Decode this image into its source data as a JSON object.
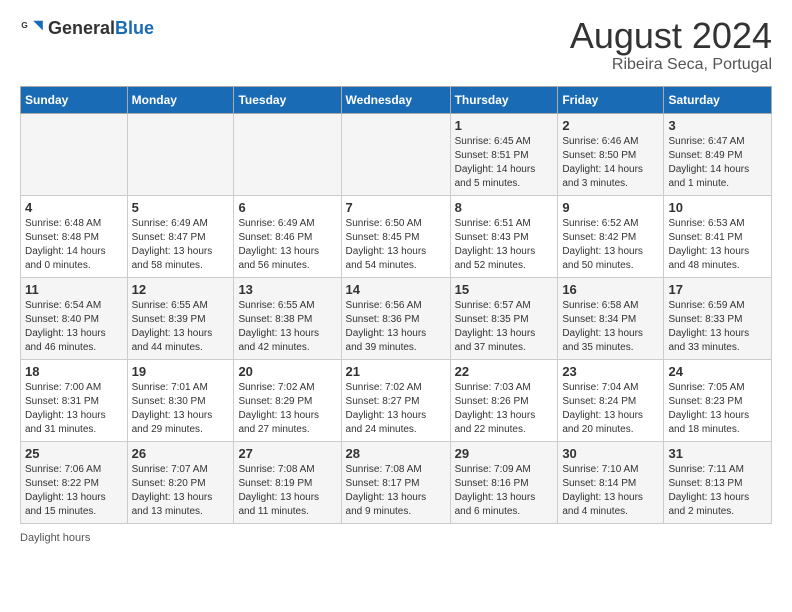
{
  "header": {
    "logo_general": "General",
    "logo_blue": "Blue",
    "title": "August 2024",
    "subtitle": "Ribeira Seca, Portugal"
  },
  "days_of_week": [
    "Sunday",
    "Monday",
    "Tuesday",
    "Wednesday",
    "Thursday",
    "Friday",
    "Saturday"
  ],
  "weeks": [
    [
      {
        "day": "",
        "info": ""
      },
      {
        "day": "",
        "info": ""
      },
      {
        "day": "",
        "info": ""
      },
      {
        "day": "",
        "info": ""
      },
      {
        "day": "1",
        "info": "Sunrise: 6:45 AM\nSunset: 8:51 PM\nDaylight: 14 hours and 5 minutes."
      },
      {
        "day": "2",
        "info": "Sunrise: 6:46 AM\nSunset: 8:50 PM\nDaylight: 14 hours and 3 minutes."
      },
      {
        "day": "3",
        "info": "Sunrise: 6:47 AM\nSunset: 8:49 PM\nDaylight: 14 hours and 1 minute."
      }
    ],
    [
      {
        "day": "4",
        "info": "Sunrise: 6:48 AM\nSunset: 8:48 PM\nDaylight: 14 hours and 0 minutes."
      },
      {
        "day": "5",
        "info": "Sunrise: 6:49 AM\nSunset: 8:47 PM\nDaylight: 13 hours and 58 minutes."
      },
      {
        "day": "6",
        "info": "Sunrise: 6:49 AM\nSunset: 8:46 PM\nDaylight: 13 hours and 56 minutes."
      },
      {
        "day": "7",
        "info": "Sunrise: 6:50 AM\nSunset: 8:45 PM\nDaylight: 13 hours and 54 minutes."
      },
      {
        "day": "8",
        "info": "Sunrise: 6:51 AM\nSunset: 8:43 PM\nDaylight: 13 hours and 52 minutes."
      },
      {
        "day": "9",
        "info": "Sunrise: 6:52 AM\nSunset: 8:42 PM\nDaylight: 13 hours and 50 minutes."
      },
      {
        "day": "10",
        "info": "Sunrise: 6:53 AM\nSunset: 8:41 PM\nDaylight: 13 hours and 48 minutes."
      }
    ],
    [
      {
        "day": "11",
        "info": "Sunrise: 6:54 AM\nSunset: 8:40 PM\nDaylight: 13 hours and 46 minutes."
      },
      {
        "day": "12",
        "info": "Sunrise: 6:55 AM\nSunset: 8:39 PM\nDaylight: 13 hours and 44 minutes."
      },
      {
        "day": "13",
        "info": "Sunrise: 6:55 AM\nSunset: 8:38 PM\nDaylight: 13 hours and 42 minutes."
      },
      {
        "day": "14",
        "info": "Sunrise: 6:56 AM\nSunset: 8:36 PM\nDaylight: 13 hours and 39 minutes."
      },
      {
        "day": "15",
        "info": "Sunrise: 6:57 AM\nSunset: 8:35 PM\nDaylight: 13 hours and 37 minutes."
      },
      {
        "day": "16",
        "info": "Sunrise: 6:58 AM\nSunset: 8:34 PM\nDaylight: 13 hours and 35 minutes."
      },
      {
        "day": "17",
        "info": "Sunrise: 6:59 AM\nSunset: 8:33 PM\nDaylight: 13 hours and 33 minutes."
      }
    ],
    [
      {
        "day": "18",
        "info": "Sunrise: 7:00 AM\nSunset: 8:31 PM\nDaylight: 13 hours and 31 minutes."
      },
      {
        "day": "19",
        "info": "Sunrise: 7:01 AM\nSunset: 8:30 PM\nDaylight: 13 hours and 29 minutes."
      },
      {
        "day": "20",
        "info": "Sunrise: 7:02 AM\nSunset: 8:29 PM\nDaylight: 13 hours and 27 minutes."
      },
      {
        "day": "21",
        "info": "Sunrise: 7:02 AM\nSunset: 8:27 PM\nDaylight: 13 hours and 24 minutes."
      },
      {
        "day": "22",
        "info": "Sunrise: 7:03 AM\nSunset: 8:26 PM\nDaylight: 13 hours and 22 minutes."
      },
      {
        "day": "23",
        "info": "Sunrise: 7:04 AM\nSunset: 8:24 PM\nDaylight: 13 hours and 20 minutes."
      },
      {
        "day": "24",
        "info": "Sunrise: 7:05 AM\nSunset: 8:23 PM\nDaylight: 13 hours and 18 minutes."
      }
    ],
    [
      {
        "day": "25",
        "info": "Sunrise: 7:06 AM\nSunset: 8:22 PM\nDaylight: 13 hours and 15 minutes."
      },
      {
        "day": "26",
        "info": "Sunrise: 7:07 AM\nSunset: 8:20 PM\nDaylight: 13 hours and 13 minutes."
      },
      {
        "day": "27",
        "info": "Sunrise: 7:08 AM\nSunset: 8:19 PM\nDaylight: 13 hours and 11 minutes."
      },
      {
        "day": "28",
        "info": "Sunrise: 7:08 AM\nSunset: 8:17 PM\nDaylight: 13 hours and 9 minutes."
      },
      {
        "day": "29",
        "info": "Sunrise: 7:09 AM\nSunset: 8:16 PM\nDaylight: 13 hours and 6 minutes."
      },
      {
        "day": "30",
        "info": "Sunrise: 7:10 AM\nSunset: 8:14 PM\nDaylight: 13 hours and 4 minutes."
      },
      {
        "day": "31",
        "info": "Sunrise: 7:11 AM\nSunset: 8:13 PM\nDaylight: 13 hours and 2 minutes."
      }
    ]
  ],
  "footer": {
    "daylight_label": "Daylight hours"
  }
}
